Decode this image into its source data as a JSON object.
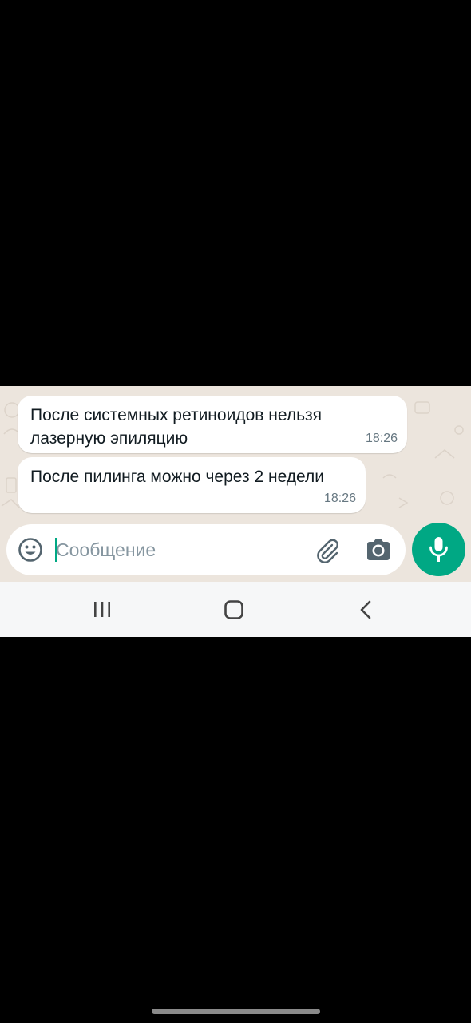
{
  "chat": {
    "messages": [
      {
        "text": "После системных ретиноидов нельзя лазерную эпиляцию",
        "time": "18:26"
      },
      {
        "text": "После пилинга можно через 2 недели",
        "time": "18:26"
      }
    ]
  },
  "composer": {
    "placeholder": "Сообщение",
    "icons": {
      "emoji": "emoji-icon",
      "attach": "paperclip-icon",
      "camera": "camera-icon",
      "send": "mic-icon"
    }
  },
  "nav_bar": {
    "buttons": [
      "recent-apps-icon",
      "home-icon",
      "back-icon"
    ]
  },
  "colors": {
    "accent": "#00A884",
    "chat_background": "#ECE5DD",
    "bubble": "#FFFFFF",
    "timestamp": "#667781",
    "nav_bar": "#F6F7F8"
  }
}
